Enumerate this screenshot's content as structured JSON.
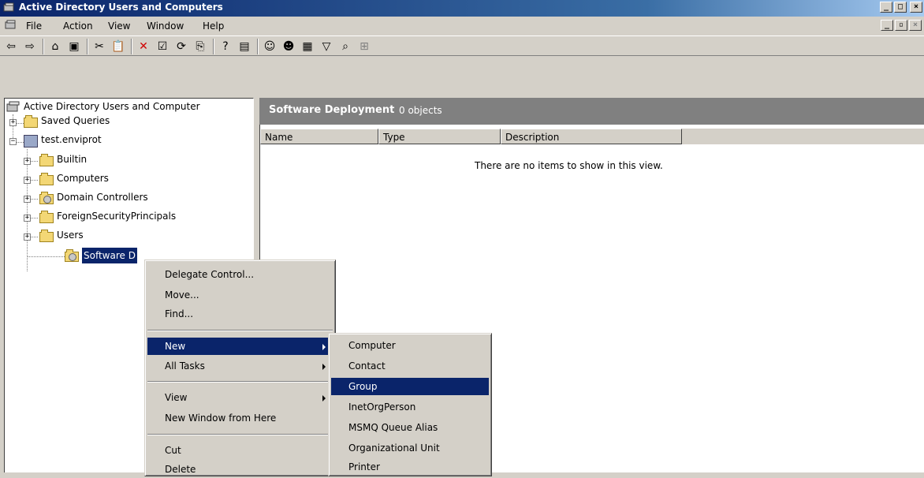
{
  "window": {
    "title": "Active Directory Users and Computers"
  },
  "menubar": {
    "items": [
      "File",
      "Action",
      "View",
      "Window",
      "Help"
    ]
  },
  "toolbar": {
    "icons": [
      "back-icon",
      "forward-icon",
      "up-folder-icon",
      "show-hide-tree-icon",
      "cut-icon",
      "paste-icon",
      "delete-icon",
      "properties-icon",
      "refresh-icon",
      "export-list-icon",
      "help-icon",
      "console-icon",
      "new-user-icon",
      "new-group-icon",
      "new-ou-icon",
      "filter-icon",
      "find-icon",
      "add-to-group-icon"
    ]
  },
  "tree": {
    "root": "Active Directory Users and Computer",
    "saved_queries": "Saved Queries",
    "domain": "test.enviprot",
    "children": [
      "Builtin",
      "Computers",
      "Domain Controllers",
      "ForeignSecurityPrincipals",
      "Users"
    ],
    "selected": "Software Deployment",
    "selected_visible": "Software D"
  },
  "right_pane": {
    "header_title": "Software Deployment",
    "header_count": "0 objects",
    "columns": [
      "Name",
      "Type",
      "Description"
    ],
    "empty_message": "There are no items to show in this view."
  },
  "context_menu": {
    "items": [
      "Delegate Control...",
      "Move...",
      "Find...",
      "New",
      "All Tasks",
      "View",
      "New Window from Here",
      "Cut",
      "Delete"
    ]
  },
  "new_submenu": {
    "items": [
      "Computer",
      "Contact",
      "Group",
      "InetOrgPerson",
      "MSMQ Queue Alias",
      "Organizational Unit",
      "Printer"
    ],
    "highlighted": "Group"
  },
  "colors": {
    "title_bar": "#0a246a",
    "highlight": "#0a246a",
    "face": "#d4d0c8",
    "header_gray": "#808080"
  }
}
